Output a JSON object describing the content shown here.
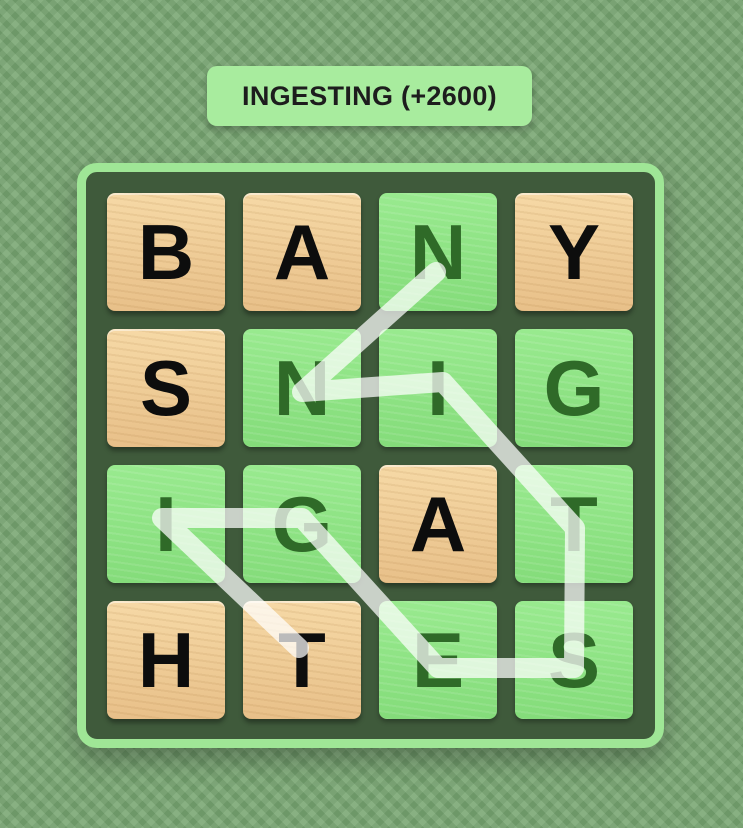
{
  "found_word": "INGESTING (+2600)",
  "colors": {
    "background": "#78a672",
    "board_border": "#9fe696",
    "board_fill": "#3f5a3b",
    "selected_tile": "#8fe585",
    "selected_letter": "#2f6a28",
    "wood_tile": "#f0cf98",
    "path_line": "#ffffff"
  },
  "grid": [
    [
      {
        "letter": "B",
        "selected": false
      },
      {
        "letter": "A",
        "selected": false
      },
      {
        "letter": "N",
        "selected": true
      },
      {
        "letter": "Y",
        "selected": false
      }
    ],
    [
      {
        "letter": "S",
        "selected": false
      },
      {
        "letter": "N",
        "selected": true
      },
      {
        "letter": "I",
        "selected": true
      },
      {
        "letter": "G",
        "selected": true
      }
    ],
    [
      {
        "letter": "I",
        "selected": true
      },
      {
        "letter": "G",
        "selected": true
      },
      {
        "letter": "A",
        "selected": false
      },
      {
        "letter": "T",
        "selected": true
      }
    ],
    [
      {
        "letter": "H",
        "selected": false
      },
      {
        "letter": "T",
        "selected": false
      },
      {
        "letter": "E",
        "selected": true
      },
      {
        "letter": "S",
        "selected": true
      }
    ]
  ],
  "path": [
    [
      2,
      0
    ],
    [
      1,
      1
    ],
    [
      2,
      1
    ],
    [
      3,
      2
    ],
    [
      3,
      3
    ],
    [
      2,
      3
    ],
    [
      1,
      2
    ],
    [
      0,
      2
    ],
    [
      1,
      3
    ]
  ]
}
